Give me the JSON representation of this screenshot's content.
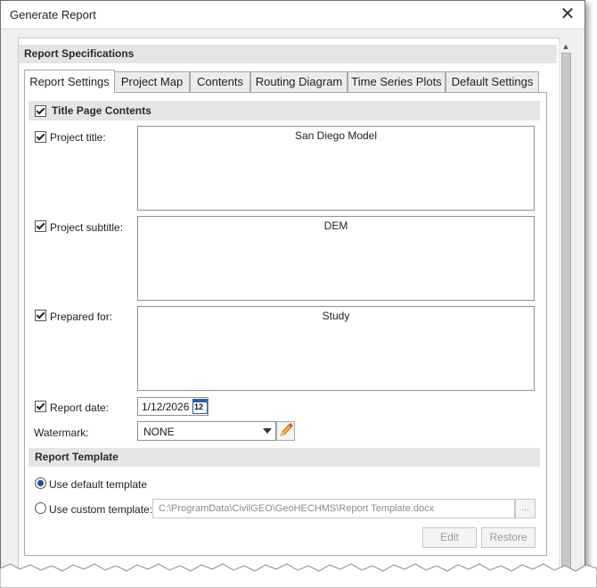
{
  "window": {
    "title": "Generate Report"
  },
  "report_specifications": {
    "header": "Report Specifications"
  },
  "tabs": [
    {
      "label": "Report Settings",
      "active": true
    },
    {
      "label": "Project Map",
      "active": false
    },
    {
      "label": "Contents",
      "active": false
    },
    {
      "label": "Routing Diagram",
      "active": false
    },
    {
      "label": "Time Series Plots",
      "active": false
    },
    {
      "label": "Default Settings",
      "active": false
    }
  ],
  "title_page": {
    "header": "Title Page Contents",
    "header_checked": true,
    "project_title": {
      "label": "Project title:",
      "checked": true,
      "value": "San Diego Model"
    },
    "project_subtitle": {
      "label": "Project subtitle:",
      "checked": true,
      "value": "DEM"
    },
    "prepared_for": {
      "label": "Prepared for:",
      "checked": true,
      "value": "Study"
    },
    "report_date": {
      "label": "Report date:",
      "checked": true,
      "value": "1/12/2026",
      "calendar_icon_text": "12"
    },
    "watermark": {
      "label": "Watermark:",
      "value": "NONE"
    }
  },
  "report_template": {
    "header": "Report Template",
    "default_label": "Use default template",
    "custom_label": "Use custom template:",
    "selected": "default",
    "custom_path": "C:\\ProgramData\\CivilGEO\\GeoHECHMS\\Report Template.docx",
    "browse_label": "...",
    "edit_label": "Edit",
    "restore_label": "Restore"
  },
  "colors": {
    "accent": "#1f4f9f",
    "header_bg": "#e5e5e5",
    "disabled_text": "#9a9a9a"
  }
}
